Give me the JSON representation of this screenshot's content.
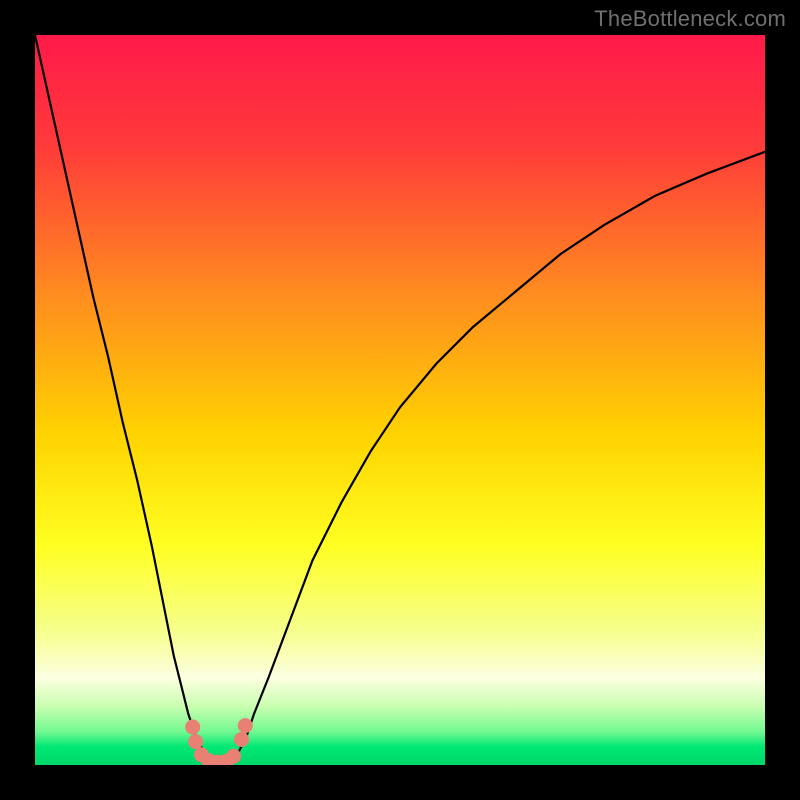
{
  "watermark": "TheBottleneck.com",
  "chart_data": {
    "type": "line",
    "title": "",
    "xlabel": "",
    "ylabel": "",
    "xlim": [
      0,
      100
    ],
    "ylim": [
      0,
      100
    ],
    "background_gradient": {
      "stops": [
        {
          "offset": 0.0,
          "color": "#ff1a4a"
        },
        {
          "offset": 0.15,
          "color": "#ff3a3a"
        },
        {
          "offset": 0.35,
          "color": "#ff8a20"
        },
        {
          "offset": 0.55,
          "color": "#ffd400"
        },
        {
          "offset": 0.7,
          "color": "#ffff22"
        },
        {
          "offset": 0.82,
          "color": "#f6ff90"
        },
        {
          "offset": 0.88,
          "color": "#fdffe0"
        },
        {
          "offset": 0.92,
          "color": "#c8ffb0"
        },
        {
          "offset": 0.955,
          "color": "#70f890"
        },
        {
          "offset": 0.975,
          "color": "#00e874"
        },
        {
          "offset": 1.0,
          "color": "#00d768"
        }
      ]
    },
    "series": [
      {
        "name": "bottleneck-curve",
        "x": [
          0,
          2,
          4,
          6,
          8,
          10,
          12,
          14,
          16,
          18,
          19,
          20,
          21,
          22,
          23,
          24,
          25,
          26,
          27,
          28,
          29,
          30,
          32,
          35,
          38,
          42,
          46,
          50,
          55,
          60,
          66,
          72,
          78,
          85,
          92,
          100
        ],
        "y": [
          100,
          91,
          82,
          73,
          64,
          56,
          47,
          39,
          30,
          20,
          15,
          11,
          7,
          4,
          2,
          0.8,
          0.4,
          0.4,
          0.8,
          2,
          4,
          7,
          12,
          20,
          28,
          36,
          43,
          49,
          55,
          60,
          65,
          70,
          74,
          78,
          81,
          84
        ]
      }
    ],
    "markers": {
      "name": "highlight-dots",
      "color": "#e98074",
      "points": [
        {
          "x": 21.6,
          "y": 5.2
        },
        {
          "x": 22.0,
          "y": 3.2
        },
        {
          "x": 22.8,
          "y": 1.4
        },
        {
          "x": 23.8,
          "y": 0.6
        },
        {
          "x": 25.0,
          "y": 0.4
        },
        {
          "x": 26.2,
          "y": 0.5
        },
        {
          "x": 27.2,
          "y": 1.2
        },
        {
          "x": 28.3,
          "y": 3.5
        },
        {
          "x": 28.8,
          "y": 5.4
        }
      ]
    }
  }
}
